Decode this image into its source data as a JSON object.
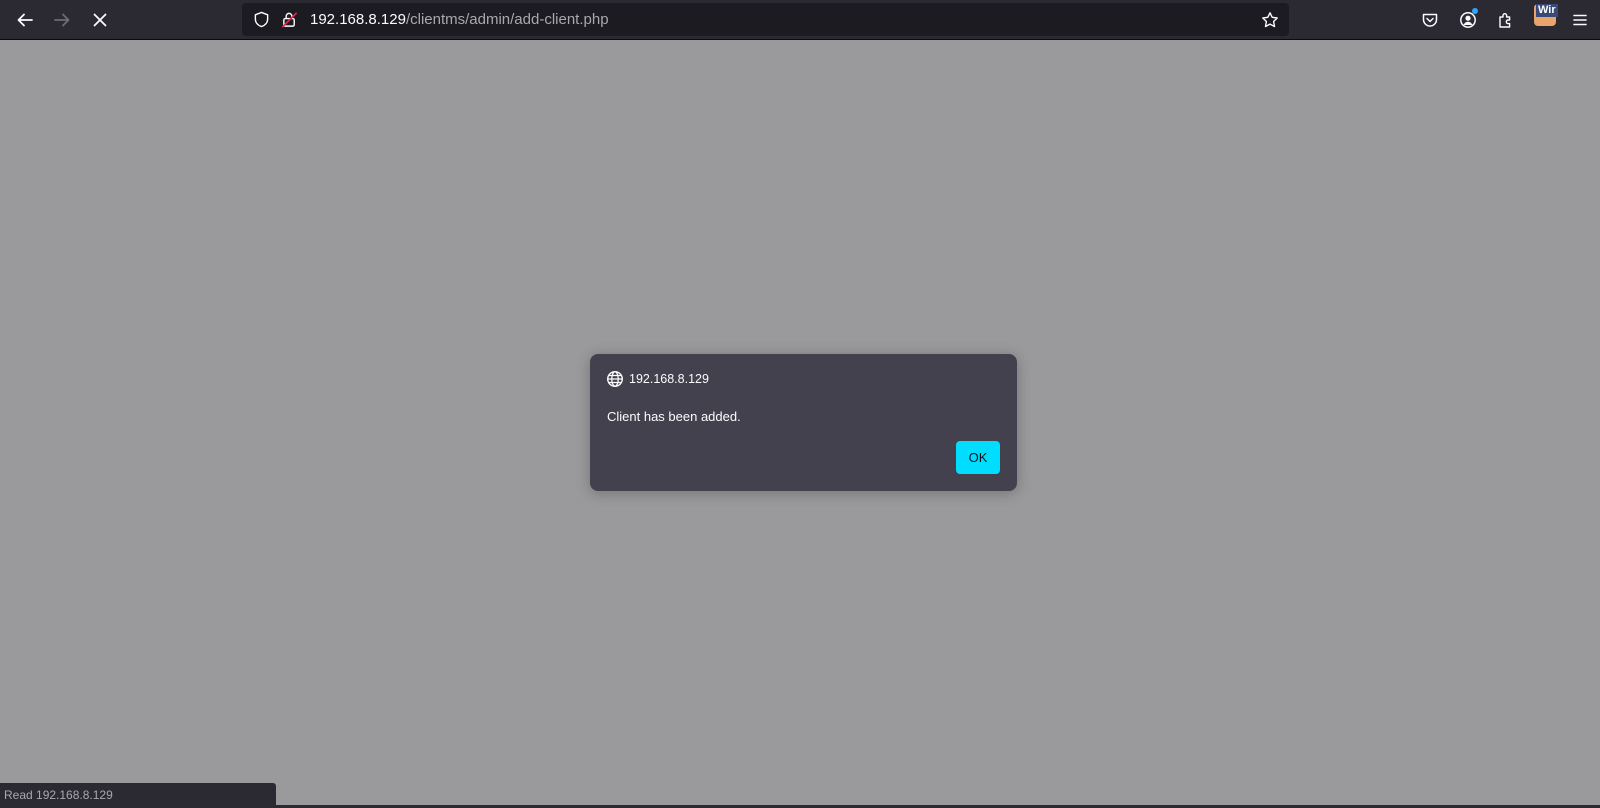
{
  "browser": {
    "url_host": "192.168.8.129",
    "url_path": "/clientms/admin/add-client.php",
    "icons": {
      "back": "back-arrow-icon",
      "forward": "forward-arrow-icon",
      "stop": "close-icon",
      "tracking": "shield-icon",
      "insecure": "insecure-lock-icon",
      "bookmark": "star-icon",
      "pocket": "pocket-icon",
      "account": "account-icon",
      "extensions": "puzzle-icon",
      "extension_badge": "Wir",
      "menu": "hamburger-menu-icon"
    }
  },
  "dialog": {
    "origin": "192.168.8.129",
    "message": "Client has been added.",
    "ok_label": "OK"
  },
  "status": {
    "text": "Read 192.168.8.129"
  },
  "colors": {
    "toolbar": "#2b2a33",
    "urlbar": "#1c1b22",
    "overlay": "#9a9a9c",
    "dialog": "#42414d",
    "accent": "#00ddff"
  }
}
